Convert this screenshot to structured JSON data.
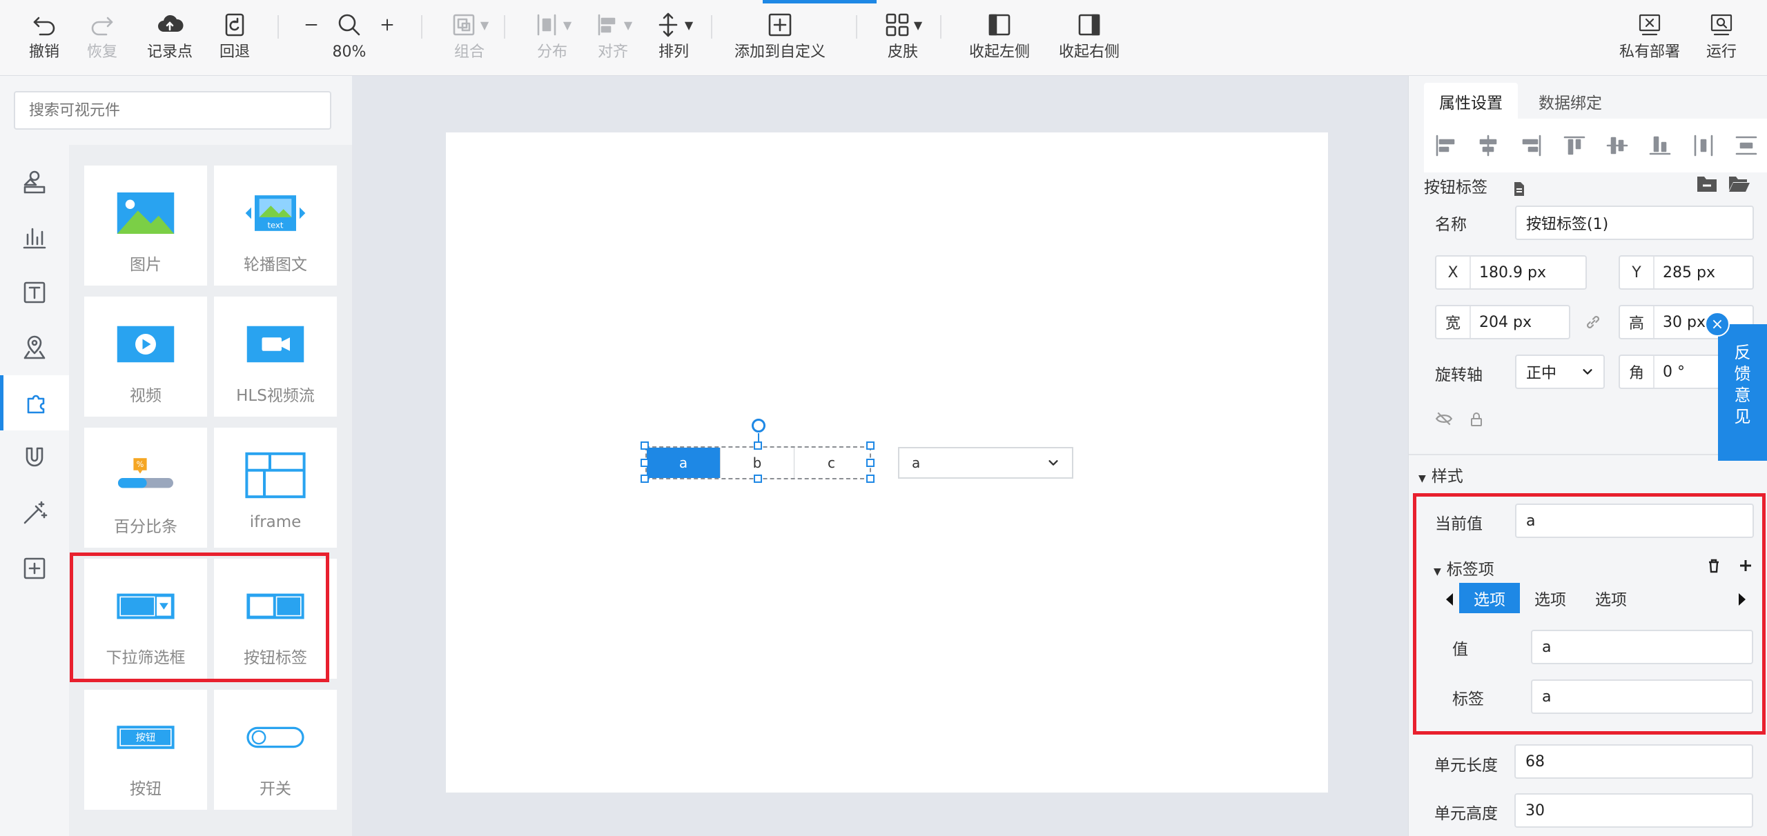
{
  "toolbar": {
    "undo": "撤销",
    "redo": "恢复",
    "checkpoint": "记录点",
    "rollback": "回退",
    "zoom": "80%",
    "group": "组合",
    "distribute": "分布",
    "align": "对齐",
    "arrange": "排列",
    "add_custom": "添加到自定义",
    "skin": "皮肤",
    "collapse_left": "收起左侧",
    "collapse_right": "收起右侧",
    "private_deploy": "私有部署",
    "run": "运行"
  },
  "left_panel": {
    "search_placeholder": "搜索可视元件",
    "components": [
      "图片",
      "轮播图文",
      "视频",
      "HLS视频流",
      "百分比条",
      "iframe",
      "下拉筛选框",
      "按钮标签",
      "按钮",
      "开关"
    ],
    "carousel_text": "text",
    "button_art_text": "按钮",
    "percent_badge": "%"
  },
  "canvas": {
    "tabs": [
      "a",
      "b",
      "c"
    ],
    "dropdown_value": "a"
  },
  "right_panel": {
    "tab_properties": "属性设置",
    "tab_binding": "数据绑定",
    "component_type": "按钮标签",
    "name_label": "名称",
    "name_value": "按钮标签(1)",
    "x_label": "X",
    "x_value": "180.9 px",
    "y_label": "Y",
    "y_value": "285 px",
    "w_label": "宽",
    "w_value": "204 px",
    "h_label": "高",
    "h_value": "30 px",
    "pivot_label": "旋转轴",
    "pivot_value": "正中",
    "angle_label": "角",
    "angle_value": "0 °",
    "style_header": "样式",
    "current_label": "当前值",
    "current_value": "a",
    "items_header": "标签项",
    "item_tabs": [
      "选项",
      "选项",
      "选项"
    ],
    "value_label": "值",
    "value_value": "a",
    "tag_label": "标签",
    "tag_value": "a",
    "unit_len_label": "单元长度",
    "unit_len_value": "68",
    "unit_h_label": "单元高度",
    "unit_h_value": "30"
  },
  "feedback": "反馈意见",
  "colors": {
    "accent": "#1e88e5",
    "highlight": "#e8202e"
  }
}
